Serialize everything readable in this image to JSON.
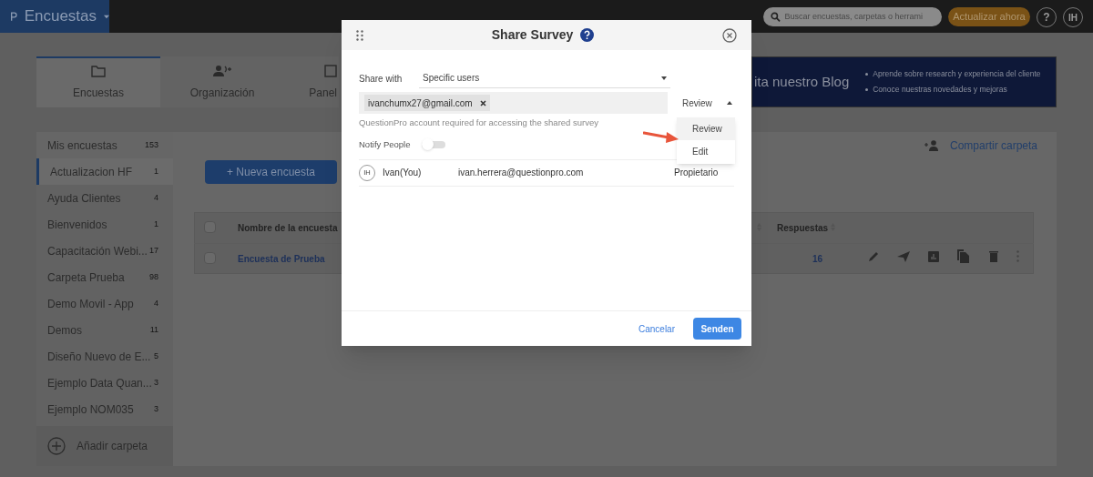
{
  "app_bar": {
    "product": "Encuestas",
    "search": {
      "placeholder": "Buscar encuestas, carpetas o herrami"
    },
    "upgrade_button": "Actualizar ahora",
    "help": "?",
    "avatar": "IH"
  },
  "tabs": [
    {
      "label": "Encuestas",
      "selected": true
    },
    {
      "label": "Organización",
      "selected": false
    },
    {
      "label": "Panel",
      "selected": false
    }
  ],
  "banner": {
    "title": "ita nuestro Blog",
    "bullets": [
      "Aprende sobre research y experiencia del cliente",
      "Conoce nuestras novedades y mejoras"
    ]
  },
  "sidebar": {
    "items": [
      {
        "label": "Mis encuestas",
        "count": "153",
        "selected": false
      },
      {
        "label": "Actualizacion HF",
        "count": "1",
        "selected": true
      },
      {
        "label": "Ayuda Clientes",
        "count": "4",
        "selected": false
      },
      {
        "label": "Bienvenidos",
        "count": "1",
        "selected": false
      },
      {
        "label": "Capacitación Webi...",
        "count": "17",
        "selected": false
      },
      {
        "label": "Carpeta Prueba",
        "count": "98",
        "selected": false
      },
      {
        "label": "Demo Movil - App",
        "count": "4",
        "selected": false
      },
      {
        "label": "Demos",
        "count": "11",
        "selected": false
      },
      {
        "label": "Diseño Nuevo de E...",
        "count": "5",
        "selected": false
      },
      {
        "label": "Ejemplo Data Quan...",
        "count": "3",
        "selected": false
      },
      {
        "label": "Ejemplo NOM035",
        "count": "3",
        "selected": false
      }
    ],
    "add_folder": "Añadir carpeta"
  },
  "new_survey_button": "+ Nueva encuesta",
  "share_folder": "Compartir carpeta",
  "table": {
    "all_selected": false,
    "columns": [
      "Nombre de la encuesta",
      "Respuestas"
    ],
    "rows": [
      {
        "name": "Encuesta de Prueba",
        "responses": "16",
        "checked": false
      }
    ]
  },
  "dialog": {
    "title": "Share Survey",
    "share_with_label": "Share with",
    "share_with": "Specific users",
    "recipients": [
      "ivanchumx27@gmail.com"
    ],
    "permission": "Review",
    "permission_open": true,
    "hint": "QuestionPro account required for accessing the shared survey",
    "notify_label": "Notify People",
    "notify": false,
    "users": [
      {
        "initials": "IH",
        "name": "Ivan(You)",
        "email": "ivan.herrera@questionpro.com",
        "role": "Propietario"
      }
    ],
    "permission_options": [
      {
        "label": "Review",
        "selected": true
      },
      {
        "label": "Edit",
        "selected": false
      }
    ],
    "cancel": "Cancelar",
    "send": "Senden"
  }
}
